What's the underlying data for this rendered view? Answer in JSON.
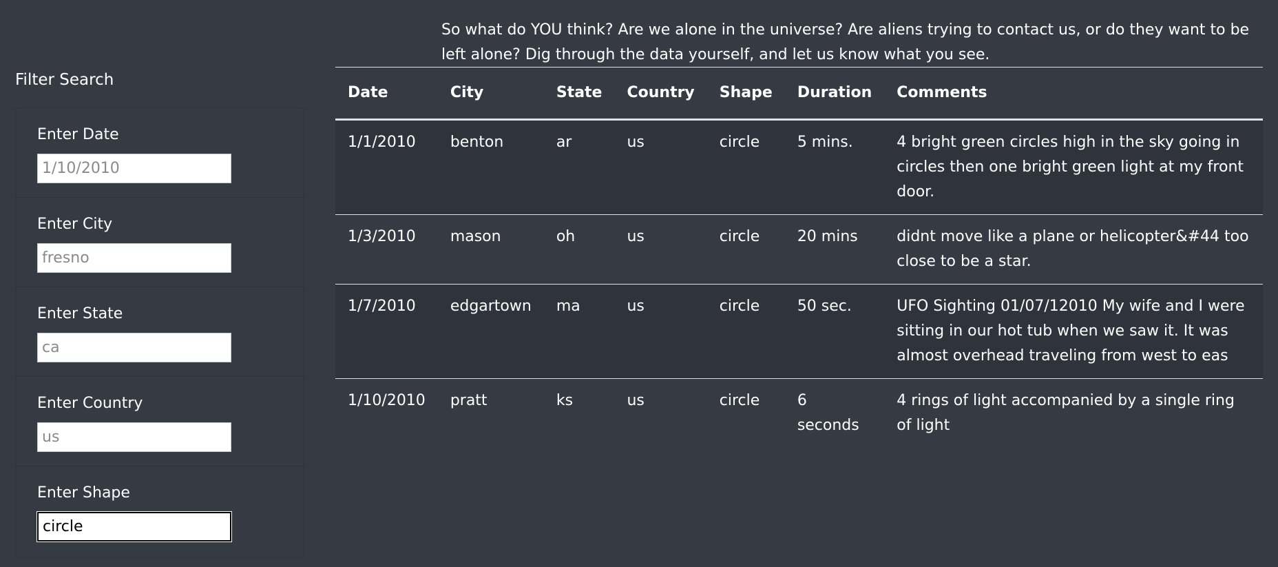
{
  "intro": {
    "text": "So what do YOU think? Are we alone in the universe? Are aliens trying to contact us, or do they want to be left alone? Dig through the data yourself, and let us know what you see."
  },
  "filters": {
    "title": "Filter Search",
    "date": {
      "label": "Enter Date",
      "placeholder": "1/10/2010",
      "value": ""
    },
    "city": {
      "label": "Enter City",
      "placeholder": "fresno",
      "value": ""
    },
    "state": {
      "label": "Enter State",
      "placeholder": "ca",
      "value": ""
    },
    "country": {
      "label": "Enter Country",
      "placeholder": "us",
      "value": ""
    },
    "shape": {
      "label": "Enter Shape",
      "placeholder": "",
      "value": "circle"
    }
  },
  "table": {
    "headers": {
      "date": "Date",
      "city": "City",
      "state": "State",
      "country": "Country",
      "shape": "Shape",
      "duration": "Duration",
      "comments": "Comments"
    },
    "rows": [
      {
        "date": "1/1/2010",
        "city": "benton",
        "state": "ar",
        "country": "us",
        "shape": "circle",
        "duration": "5 mins.",
        "comments": "4 bright green circles high in the sky going in circles then one bright green light at my front door."
      },
      {
        "date": "1/3/2010",
        "city": "mason",
        "state": "oh",
        "country": "us",
        "shape": "circle",
        "duration": "20 mins",
        "comments": "didnt move like a plane or helicopter&#44 too close to be a star."
      },
      {
        "date": "1/7/2010",
        "city": "edgartown",
        "state": "ma",
        "country": "us",
        "shape": "circle",
        "duration": "50 sec.",
        "comments": "UFO Sighting 01/07/12010 My wife and I were sitting in our hot tub when we saw it. It was almost overhead traveling from west to eas"
      },
      {
        "date": "1/10/2010",
        "city": "pratt",
        "state": "ks",
        "country": "us",
        "shape": "circle",
        "duration": "6 seconds",
        "comments": "4 rings of light accompanied by a single ring of light"
      }
    ]
  }
}
